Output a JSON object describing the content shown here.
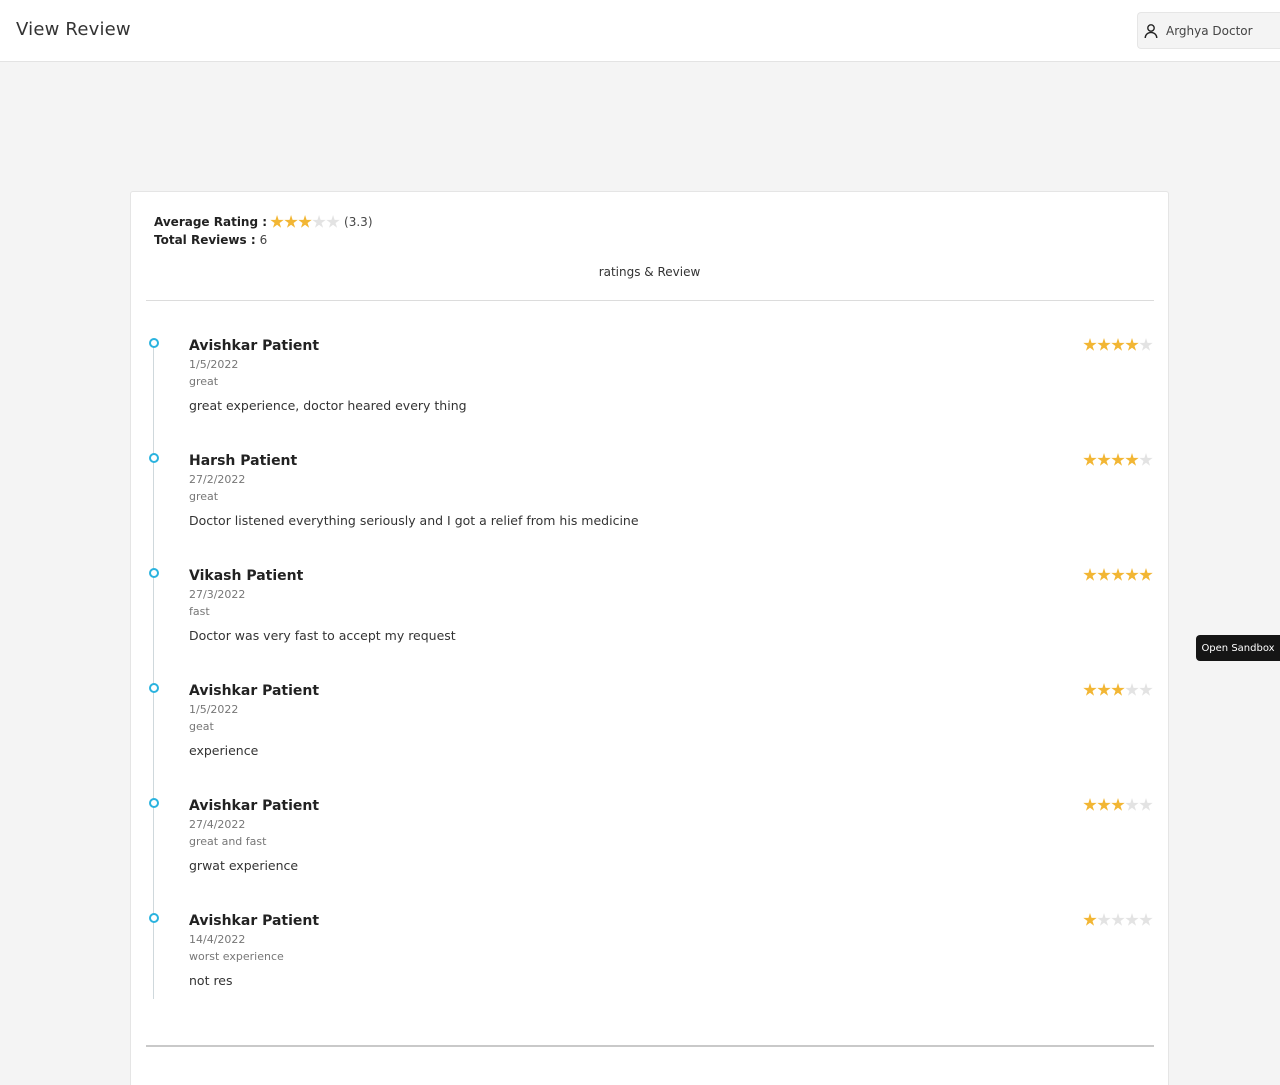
{
  "header": {
    "title": "View Review",
    "user_name": "Arghya Doctor"
  },
  "summary": {
    "average_label": "Average Rating :",
    "average_value": "(3.3)",
    "average_stars": 3,
    "total_label": "Total Reviews :",
    "total_value": "6"
  },
  "section_title": "ratings & Review",
  "reviews": [
    {
      "name": "Avishkar Patient",
      "date": "1/5/2022",
      "title": "great",
      "body": "great experience, doctor heared every thing",
      "rating": 4
    },
    {
      "name": "Harsh Patient",
      "date": "27/2/2022",
      "title": "great",
      "body": "Doctor listened everything seriously and I got a relief from his medicine",
      "rating": 4
    },
    {
      "name": "Vikash Patient",
      "date": "27/3/2022",
      "title": "fast",
      "body": "Doctor was very fast to accept my request",
      "rating": 5
    },
    {
      "name": "Avishkar Patient",
      "date": "1/5/2022",
      "title": "geat",
      "body": "experience",
      "rating": 3
    },
    {
      "name": "Avishkar Patient",
      "date": "27/4/2022",
      "title": "great and fast",
      "body": "grwat experience",
      "rating": 3
    },
    {
      "name": "Avishkar Patient",
      "date": "14/4/2022",
      "title": "worst experience",
      "body": "not res",
      "rating": 1
    }
  ],
  "sandbox_label": "Open Sandbox",
  "colors": {
    "star_filled": "#f2b634",
    "star_empty": "#e3e3e3",
    "timeline_dot": "#2ab3df"
  }
}
